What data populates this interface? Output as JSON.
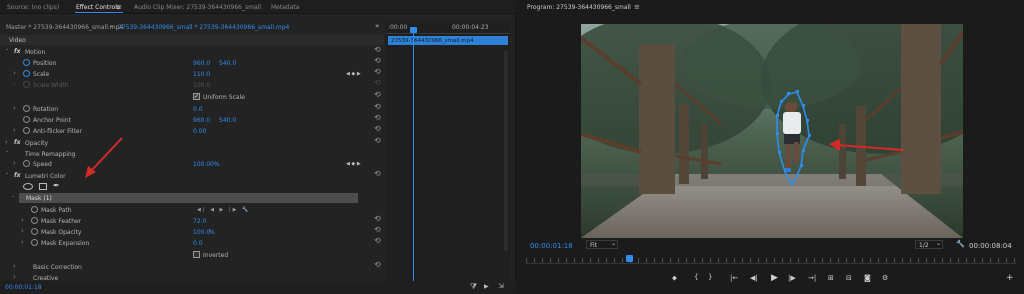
{
  "tabs": {
    "source": "Source: (no clips)",
    "effect_controls": "Effect Controls",
    "menu": "≡",
    "audio_mixer": "Audio Clip Mixer: 27539-364430966_small",
    "metadata": "Metadata"
  },
  "breadcrumb": {
    "master": "Master * 27539-364430966_small.mp4",
    "sequence": "27539-364430966_small * 27539-364430966_small.mp4"
  },
  "timeline": {
    "start": ":00:00",
    "end": "00:00:04:23",
    "clip": "27539-364430966_small.mp4"
  },
  "effects": {
    "video_header": "Video",
    "fx": "fx",
    "motion": "Motion",
    "position_label": "Position",
    "position_x": "960.0",
    "position_y": "540.0",
    "scale_label": "Scale",
    "scale_value": "110.0",
    "scale_width_label": "Scale Width",
    "scale_width_value": "100.0",
    "uniform_scale": "Uniform Scale",
    "rotation_label": "Rotation",
    "rotation_value": "0.0",
    "anchor_label": "Anchor Point",
    "anchor_x": "960.0",
    "anchor_y": "540.0",
    "antiflicker_label": "Anti-flicker Filter",
    "antiflicker_value": "0.00",
    "opacity": "Opacity",
    "time_remap": "Time Remapping",
    "speed_label": "Speed",
    "speed_value": "100.00%",
    "lumetri": "Lumetri Color",
    "mask_name": "Mask (1)",
    "mask_path": "Mask Path",
    "mask_feather": "Mask Feather",
    "mask_feather_value": "72.0",
    "mask_opacity": "Mask Opacity",
    "mask_opacity_value": "100.0",
    "mask_opacity_unit": "%",
    "mask_expansion": "Mask Expansion",
    "mask_expansion_value": "0.0",
    "inverted": "Inverted",
    "basic_correction": "Basic Correction",
    "creative": "Creative",
    "timecode": "00:00:01:18"
  },
  "program": {
    "title": "Program: 27539-364430966_small",
    "menu": "≡",
    "timecode": "00:00:01:18",
    "fit": "Fit",
    "resolution": "1/2",
    "duration": "00:00:08:04"
  },
  "icons": {
    "reset": "⟲",
    "chevron": "›",
    "chevron_down": "⌄",
    "menu_right": "»",
    "play": "▶",
    "step_back": "◀|",
    "step_fwd": "|▶",
    "marker": "⬥",
    "in": "{",
    "out": "}",
    "camera": "📷",
    "plus": "+",
    "wrench": "🔧",
    "filter": "⧩"
  },
  "colors": {
    "accent": "#2f8ded",
    "arrow_red": "#d42a2a",
    "panel": "#232323",
    "dark": "#1b1b1b"
  }
}
